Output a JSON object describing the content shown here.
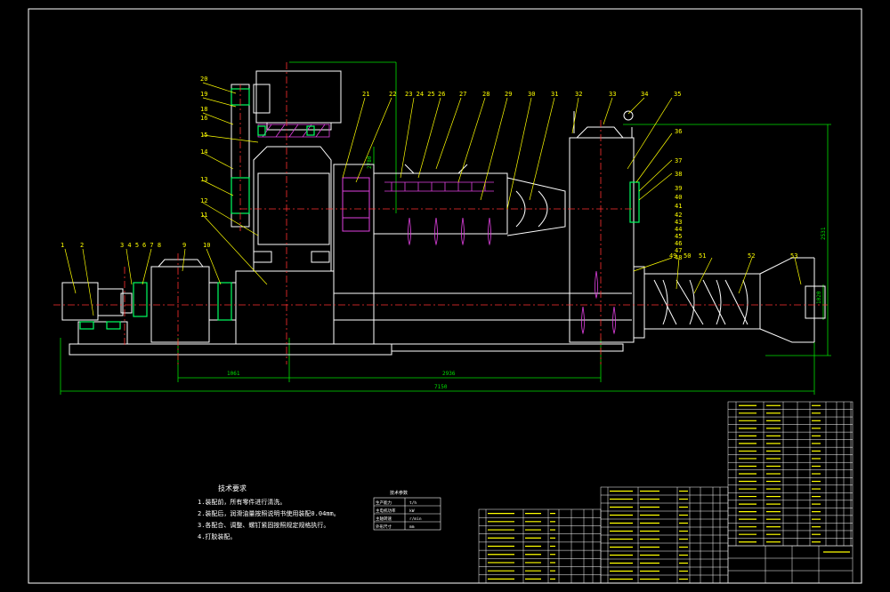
{
  "drawing": {
    "background": "#000000",
    "colors": {
      "frame": "#ffffff",
      "outline": "#ffffff",
      "leader": "#ffff00",
      "centerline": "#ff3030",
      "dimension": "#00e000",
      "hatch": "#e040e0",
      "part_highlight": "#00ff60",
      "label": "#ffff00",
      "table_line": "#ffffff",
      "table_text": "#ffff00"
    }
  },
  "part_numbers_left": [
    "20",
    "19",
    "18",
    "16",
    "15",
    "14",
    "13",
    "12",
    "11",
    "1",
    "2",
    "3 4 5",
    "6 7 8",
    "9",
    "10"
  ],
  "part_numbers_top": [
    "21",
    "22",
    "23 24 25",
    "26",
    "27",
    "28",
    "29",
    "30",
    "31",
    "32",
    "33",
    "34",
    "35"
  ],
  "part_numbers_right": [
    "36",
    "37",
    "38",
    "39",
    "40",
    "41",
    "42",
    "43",
    "44",
    "45",
    "46",
    "47",
    "48"
  ],
  "part_numbers_screw": [
    "49",
    "50",
    "51",
    "52",
    "53"
  ],
  "dimensions": {
    "d1061": "1061",
    "d2936": "2936",
    "d7150": "7150",
    "d2780": "2780",
    "d2531": "2531",
    "d1020": "1020"
  },
  "notes": {
    "title": "技术要求",
    "lines": [
      "1.装配前，所有零件进行清洗。",
      "2.装配后，润滑油量按照说明书使用装配0.04mm。",
      "3.各配合、调整、螺钉紧固按照规定规格执行。",
      "4.打胶装配。"
    ]
  },
  "spec_table": {
    "title": "技术参数",
    "rows": [
      [
        "生产能力",
        "t/h"
      ],
      [
        "主电机功率",
        "kW"
      ],
      [
        "主轴转速",
        "r/min"
      ],
      [
        "外形尺寸",
        "mm"
      ]
    ]
  }
}
